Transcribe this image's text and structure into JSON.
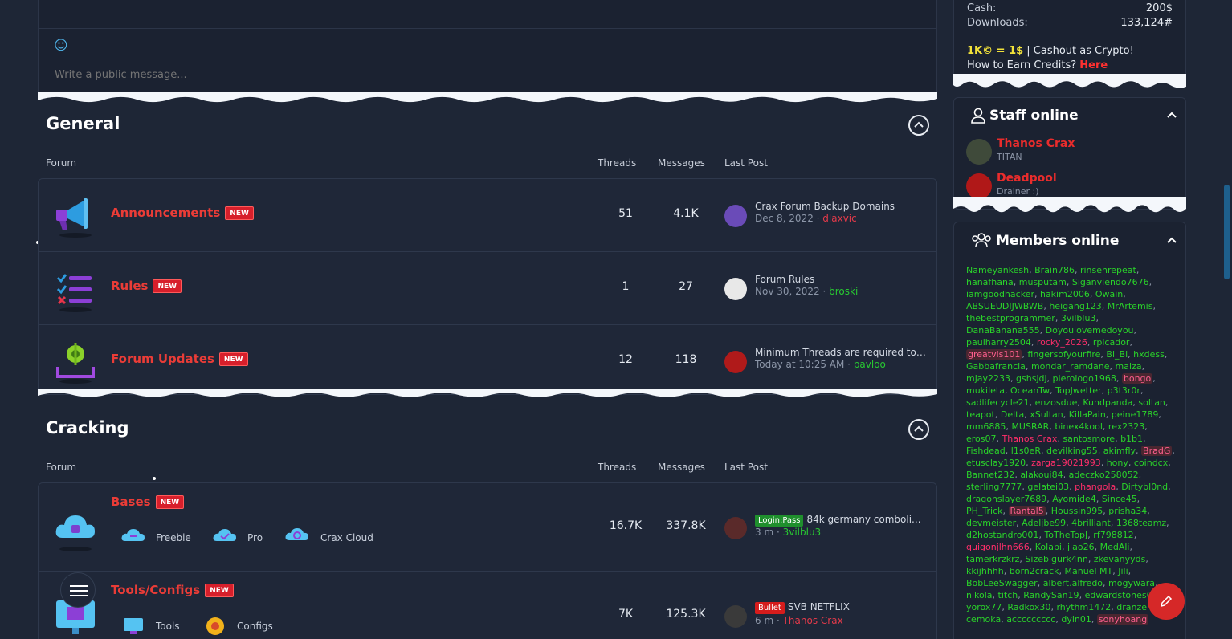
{
  "chat": {
    "placeholder": "Write a public message..."
  },
  "general": {
    "title": "General",
    "columns": {
      "forum": "Forum",
      "threads": "Threads",
      "messages": "Messages",
      "last_post": "Last Post"
    },
    "nodes": [
      {
        "title": "Announcements",
        "badge": "NEW",
        "threads": "51",
        "messages": "4.1K",
        "lp_title": "Crax Forum Backup Domains",
        "lp_date": "Dec 8, 2022",
        "lp_sep": " · ",
        "lp_user": "dlaxvic"
      },
      {
        "title": "Rules",
        "badge": "NEW",
        "threads": "1",
        "messages": "27",
        "lp_title": "Forum Rules",
        "lp_date": "Nov 30, 2022",
        "lp_sep": " · ",
        "lp_user": "broski"
      },
      {
        "title": "Forum Updates",
        "badge": "NEW",
        "threads": "12",
        "messages": "118",
        "lp_title": "Minimum Threads are required to re...",
        "lp_date": "Today at 10:25 AM",
        "lp_sep": " · ",
        "lp_user": "pavloo"
      }
    ]
  },
  "cracking": {
    "title": "Cracking",
    "columns": {
      "forum": "Forum",
      "threads": "Threads",
      "messages": "Messages",
      "last_post": "Last Post"
    },
    "nodes": [
      {
        "title": "Bases",
        "badge": "NEW",
        "threads": "16.7K",
        "messages": "337.8K",
        "subforums": [
          "Freebie",
          "Pro",
          "Crax Cloud"
        ],
        "lp_prefix": "Login:Pass",
        "lp_title": "84k germany comboli...",
        "lp_date": "3 m",
        "lp_sep": " · ",
        "lp_user": "3vilblu3"
      },
      {
        "title": "Tools/Configs",
        "badge": "NEW",
        "threads": "7K",
        "messages": "125.3K",
        "subforums": [
          "Tools",
          "Configs"
        ],
        "lp_prefix": "Bullet",
        "lp_title": "SVB NETFLIX",
        "lp_date": "6 m",
        "lp_sep": " · ",
        "lp_user": "Thanos Crax"
      }
    ]
  },
  "account": {
    "cash_label": "Cash:",
    "cash_value": "200$",
    "downloads_label": "Downloads:",
    "downloads_value": "133,124#",
    "rate_bold": "1K© = 1$",
    "rate_text": " | Cashout as Crypto!",
    "earn_text": "How to Earn Credits? ",
    "earn_link": "Here"
  },
  "staff": {
    "title": "Staff online",
    "members": [
      {
        "name": "Thanos Crax",
        "role": "TITAN"
      },
      {
        "name": "Deadpool",
        "role": "Drainer :)"
      }
    ]
  },
  "members_online": {
    "title": "Members online",
    "names": [
      [
        "Nameyankesh",
        "g"
      ],
      [
        "Brain786",
        "g"
      ],
      [
        "rinsenrepeat",
        "g"
      ],
      [
        "hanafhana",
        "g"
      ],
      [
        "musputam",
        "g"
      ],
      [
        "Siganviendo7676",
        "g"
      ],
      [
        "iamgoodhacker",
        "g"
      ],
      [
        "hakim2006",
        "g"
      ],
      [
        "Owain",
        "g"
      ],
      [
        "ABSUEUDIJWBWB",
        "g"
      ],
      [
        "heigang123",
        "g"
      ],
      [
        "MrArtemis",
        "g"
      ],
      [
        "thebestprogrammer",
        "g"
      ],
      [
        "3vilblu3",
        "g"
      ],
      [
        "DanaBanana555",
        "g"
      ],
      [
        "Doyoulovemedoyou",
        "g"
      ],
      [
        "paulharry2504",
        "g"
      ],
      [
        "rocky_2026",
        "r"
      ],
      [
        "rpicador",
        "g"
      ],
      [
        "greatvls101",
        "h"
      ],
      [
        "fingersofyourfire",
        "g"
      ],
      [
        "Bi_Bi",
        "g"
      ],
      [
        "hxdess",
        "g"
      ],
      [
        "Gabbafrancia",
        "g"
      ],
      [
        "mondar_ramdane",
        "g"
      ],
      [
        "maiza",
        "g"
      ],
      [
        "mjay2233",
        "g"
      ],
      [
        "gshsjdj",
        "g"
      ],
      [
        "pierologo1968",
        "g"
      ],
      [
        "bongo",
        "h"
      ],
      [
        "mukileta",
        "g"
      ],
      [
        "OceanTw",
        "g"
      ],
      [
        "TopJwetter",
        "g"
      ],
      [
        "p3t3r0r",
        "g"
      ],
      [
        "sadlifecycle21",
        "g"
      ],
      [
        "enzosdue",
        "g"
      ],
      [
        "Kundpanda",
        "g"
      ],
      [
        "soltan",
        "g"
      ],
      [
        "teapot",
        "g"
      ],
      [
        "Delta",
        "g"
      ],
      [
        "xSultan",
        "g"
      ],
      [
        "KillaPain",
        "g"
      ],
      [
        "peine1789",
        "g"
      ],
      [
        "mm6885",
        "g"
      ],
      [
        "MUSRAR",
        "g"
      ],
      [
        "binex4kool",
        "g"
      ],
      [
        "rex2323",
        "g"
      ],
      [
        "eros07",
        "g"
      ],
      [
        "Thanos Crax",
        "r"
      ],
      [
        "santosmore",
        "g"
      ],
      [
        "b1b1",
        "g"
      ],
      [
        "Fishdead",
        "g"
      ],
      [
        "l1s0eR",
        "g"
      ],
      [
        "devilking55",
        "g"
      ],
      [
        "akimfly",
        "g"
      ],
      [
        "BradG",
        "h"
      ],
      [
        "etusclay1920",
        "g"
      ],
      [
        "zarga19021993",
        "r"
      ],
      [
        "hony",
        "g"
      ],
      [
        "coindcx",
        "g"
      ],
      [
        "Bannet232",
        "g"
      ],
      [
        "alakoui84",
        "g"
      ],
      [
        "adeczko258052",
        "g"
      ],
      [
        "sterling7777",
        "g"
      ],
      [
        "gelatei03",
        "g"
      ],
      [
        "phangola",
        "r"
      ],
      [
        "Dirtybl0nd",
        "g"
      ],
      [
        "dragonslayer7689",
        "g"
      ],
      [
        "Ayomide4",
        "g"
      ],
      [
        "Since45",
        "g"
      ],
      [
        "PH_Trick",
        "g"
      ],
      [
        "Rantal5",
        "h"
      ],
      [
        "Houssin995",
        "g"
      ],
      [
        "prisha34",
        "g"
      ],
      [
        "devmeister",
        "g"
      ],
      [
        "Adeljbe99",
        "g"
      ],
      [
        "4brilliant",
        "g"
      ],
      [
        "1368teamz",
        "g"
      ],
      [
        "d2hostandro001",
        "g"
      ],
      [
        "ToTheTopJ",
        "g"
      ],
      [
        "rf798812",
        "g"
      ],
      [
        "quigonjlhn666",
        "r"
      ],
      [
        "Kolapi",
        "g"
      ],
      [
        "jlao26",
        "g"
      ],
      [
        "MedAli",
        "g"
      ],
      [
        "tamerkrzkrz",
        "g"
      ],
      [
        "Sizebigurk4nn",
        "g"
      ],
      [
        "zkevanyyds",
        "g"
      ],
      [
        "kkijhhhh",
        "g"
      ],
      [
        "born2crack",
        "g"
      ],
      [
        "Manuel MT",
        "g"
      ],
      [
        "Jili",
        "g"
      ],
      [
        "BobLeeSwagger",
        "g"
      ],
      [
        "albert.alfredo",
        "g"
      ],
      [
        "mogywara",
        "g"
      ],
      [
        "nikola",
        "g"
      ],
      [
        "titch",
        "g"
      ],
      [
        "RandySan19",
        "g"
      ],
      [
        "edwardstones00",
        "g"
      ],
      [
        "yorox77",
        "g"
      ],
      [
        "Radkox30",
        "g"
      ],
      [
        "rhythm1472",
        "g"
      ],
      [
        "dranzerk1",
        "g"
      ],
      [
        "cemoka",
        "g"
      ],
      [
        "accccccccc",
        "g"
      ],
      [
        "dyln01",
        "g"
      ],
      [
        "sonyhoang",
        "h"
      ]
    ]
  },
  "colors": {
    "accent_red": "#ea3c37",
    "online_green": "#2ad22a",
    "badge_red": "#d71f2b",
    "panel_bg": "#1f2738",
    "page_bg": "#1e2636"
  },
  "icons": [
    "smile-icon",
    "megaphone-icon",
    "checklist-icon",
    "gear-download-icon",
    "cloud-lock-icon",
    "monitor-icon",
    "chevron-up-icon",
    "user-icon",
    "users-icon",
    "menu-icon",
    "edit-icon"
  ]
}
